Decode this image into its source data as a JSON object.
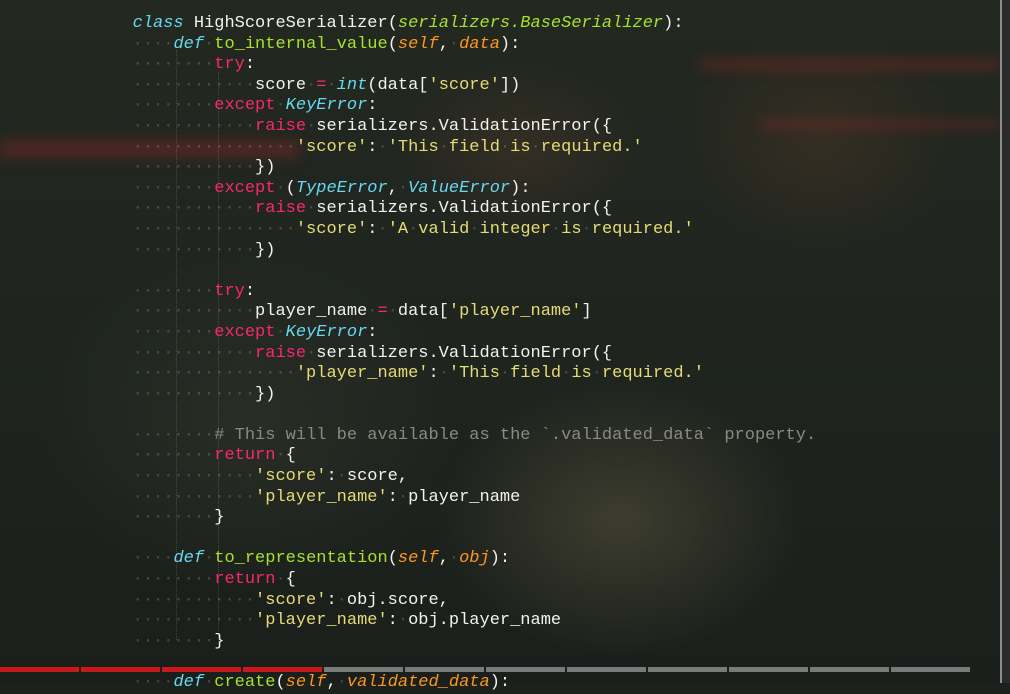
{
  "editor": {
    "theme_colors": {
      "keyword": "#f92672",
      "storage": "#66d9ef",
      "function": "#a6e22e",
      "parameter": "#fd971f",
      "string": "#e6db74",
      "comment": "#8a8a80",
      "plain": "#f2f2ee"
    },
    "lines": [
      [
        {
          "t": "class",
          "c": "st"
        },
        {
          "t": " "
        },
        {
          "t": "HighScoreSerializer",
          "c": "pl"
        },
        {
          "t": "("
        },
        {
          "t": "serializers.BaseSerializer",
          "c": "fn-i"
        },
        {
          "t": "):"
        }
      ],
      [
        {
          "i": "····"
        },
        {
          "t": "def",
          "c": "st"
        },
        {
          "i": "·"
        },
        {
          "t": "to_internal_value",
          "c": "fn"
        },
        {
          "t": "("
        },
        {
          "t": "self",
          "c": "pa"
        },
        {
          "t": ","
        },
        {
          "i": "·"
        },
        {
          "t": "data",
          "c": "pa"
        },
        {
          "t": "):"
        }
      ],
      [
        {
          "i": "········"
        },
        {
          "t": "try",
          "c": "kw"
        },
        {
          "t": ":"
        }
      ],
      [
        {
          "i": "············"
        },
        {
          "t": "score"
        },
        {
          "i": "·"
        },
        {
          "t": "=",
          "c": "kw"
        },
        {
          "i": "·"
        },
        {
          "t": "int",
          "c": "ty"
        },
        {
          "t": "(data["
        },
        {
          "t": "'score'",
          "c": "str"
        },
        {
          "t": "])"
        }
      ],
      [
        {
          "i": "········"
        },
        {
          "t": "except",
          "c": "kw"
        },
        {
          "i": "·"
        },
        {
          "t": "KeyError",
          "c": "ty"
        },
        {
          "t": ":"
        }
      ],
      [
        {
          "i": "············"
        },
        {
          "t": "raise",
          "c": "kw"
        },
        {
          "i": "·"
        },
        {
          "t": "serializers.ValidationError({"
        }
      ],
      [
        {
          "i": "················"
        },
        {
          "t": "'score'",
          "c": "str"
        },
        {
          "t": ":"
        },
        {
          "i": "·"
        },
        {
          "t": "'This",
          "c": "str"
        },
        {
          "i": "·"
        },
        {
          "t": "field",
          "c": "str"
        },
        {
          "i": "·"
        },
        {
          "t": "is",
          "c": "str"
        },
        {
          "i": "·"
        },
        {
          "t": "required.'",
          "c": "str"
        }
      ],
      [
        {
          "i": "············"
        },
        {
          "t": "})"
        }
      ],
      [
        {
          "i": "········"
        },
        {
          "t": "except",
          "c": "kw"
        },
        {
          "i": "·"
        },
        {
          "t": "("
        },
        {
          "t": "TypeError",
          "c": "ty"
        },
        {
          "t": ","
        },
        {
          "i": "·"
        },
        {
          "t": "ValueError",
          "c": "ty"
        },
        {
          "t": "):"
        }
      ],
      [
        {
          "i": "············"
        },
        {
          "t": "raise",
          "c": "kw"
        },
        {
          "i": "·"
        },
        {
          "t": "serializers.ValidationError({"
        }
      ],
      [
        {
          "i": "················"
        },
        {
          "t": "'score'",
          "c": "str"
        },
        {
          "t": ":"
        },
        {
          "i": "·"
        },
        {
          "t": "'A",
          "c": "str"
        },
        {
          "i": "·"
        },
        {
          "t": "valid",
          "c": "str"
        },
        {
          "i": "·"
        },
        {
          "t": "integer",
          "c": "str"
        },
        {
          "i": "·"
        },
        {
          "t": "is",
          "c": "str"
        },
        {
          "i": "·"
        },
        {
          "t": "required.'",
          "c": "str"
        }
      ],
      [
        {
          "i": "············"
        },
        {
          "t": "})"
        }
      ],
      [],
      [
        {
          "i": "········"
        },
        {
          "t": "try",
          "c": "kw"
        },
        {
          "t": ":"
        }
      ],
      [
        {
          "i": "············"
        },
        {
          "t": "player_name"
        },
        {
          "i": "·"
        },
        {
          "t": "=",
          "c": "kw"
        },
        {
          "i": "·"
        },
        {
          "t": "data["
        },
        {
          "t": "'player_name'",
          "c": "str"
        },
        {
          "t": "]"
        }
      ],
      [
        {
          "i": "········"
        },
        {
          "t": "except",
          "c": "kw"
        },
        {
          "i": "·"
        },
        {
          "t": "KeyError",
          "c": "ty"
        },
        {
          "t": ":"
        }
      ],
      [
        {
          "i": "············"
        },
        {
          "t": "raise",
          "c": "kw"
        },
        {
          "i": "·"
        },
        {
          "t": "serializers.ValidationError({"
        }
      ],
      [
        {
          "i": "················"
        },
        {
          "t": "'player_name'",
          "c": "str"
        },
        {
          "t": ":"
        },
        {
          "i": "·"
        },
        {
          "t": "'This",
          "c": "str"
        },
        {
          "i": "·"
        },
        {
          "t": "field",
          "c": "str"
        },
        {
          "i": "·"
        },
        {
          "t": "is",
          "c": "str"
        },
        {
          "i": "·"
        },
        {
          "t": "required.'",
          "c": "str"
        }
      ],
      [
        {
          "i": "············"
        },
        {
          "t": "})"
        }
      ],
      [],
      [
        {
          "i": "········"
        },
        {
          "t": "# This will be available as the `.validated_data` property.",
          "c": "cm"
        }
      ],
      [
        {
          "i": "········"
        },
        {
          "t": "return",
          "c": "kw"
        },
        {
          "i": "·"
        },
        {
          "t": "{"
        }
      ],
      [
        {
          "i": "············"
        },
        {
          "t": "'score'",
          "c": "str"
        },
        {
          "t": ":"
        },
        {
          "i": "·"
        },
        {
          "t": "score,"
        }
      ],
      [
        {
          "i": "············"
        },
        {
          "t": "'player_name'",
          "c": "str"
        },
        {
          "t": ":"
        },
        {
          "i": "·"
        },
        {
          "t": "player_name"
        }
      ],
      [
        {
          "i": "········"
        },
        {
          "t": "}"
        }
      ],
      [],
      [
        {
          "i": "····"
        },
        {
          "t": "def",
          "c": "st"
        },
        {
          "i": "·"
        },
        {
          "t": "to_representation",
          "c": "fn"
        },
        {
          "t": "("
        },
        {
          "t": "self",
          "c": "pa"
        },
        {
          "t": ","
        },
        {
          "i": "·"
        },
        {
          "t": "obj",
          "c": "pa"
        },
        {
          "t": "):"
        }
      ],
      [
        {
          "i": "········"
        },
        {
          "t": "return",
          "c": "kw"
        },
        {
          "i": "·"
        },
        {
          "t": "{"
        }
      ],
      [
        {
          "i": "············"
        },
        {
          "t": "'score'",
          "c": "str"
        },
        {
          "t": ":"
        },
        {
          "i": "·"
        },
        {
          "t": "obj.score,"
        }
      ],
      [
        {
          "i": "············"
        },
        {
          "t": "'player_name'",
          "c": "str"
        },
        {
          "t": ":"
        },
        {
          "i": "·"
        },
        {
          "t": "obj.player_name"
        }
      ],
      [
        {
          "i": "········"
        },
        {
          "t": "}"
        }
      ],
      [],
      [
        {
          "i": "····"
        },
        {
          "t": "def",
          "c": "st"
        },
        {
          "i": "·"
        },
        {
          "t": "create",
          "c": "fn"
        },
        {
          "t": "("
        },
        {
          "t": "self",
          "c": "pa"
        },
        {
          "t": ","
        },
        {
          "i": "·"
        },
        {
          "t": "validated_data",
          "c": "pa"
        },
        {
          "t": "):"
        }
      ]
    ]
  },
  "tabbar": {
    "segments": [
      {
        "color": "#c8191d"
      },
      {
        "color": "#c8191d"
      },
      {
        "color": "#c8191d"
      },
      {
        "color": "#c8191d"
      },
      {
        "color": "#7a7a7a"
      },
      {
        "color": "#7a7a7a"
      },
      {
        "color": "#7a7a7a"
      },
      {
        "color": "#7a7a7a"
      },
      {
        "color": "#7a7a7a"
      },
      {
        "color": "#7a7a7a"
      },
      {
        "color": "#7a7a7a"
      },
      {
        "color": "#7a7a7a"
      }
    ]
  }
}
